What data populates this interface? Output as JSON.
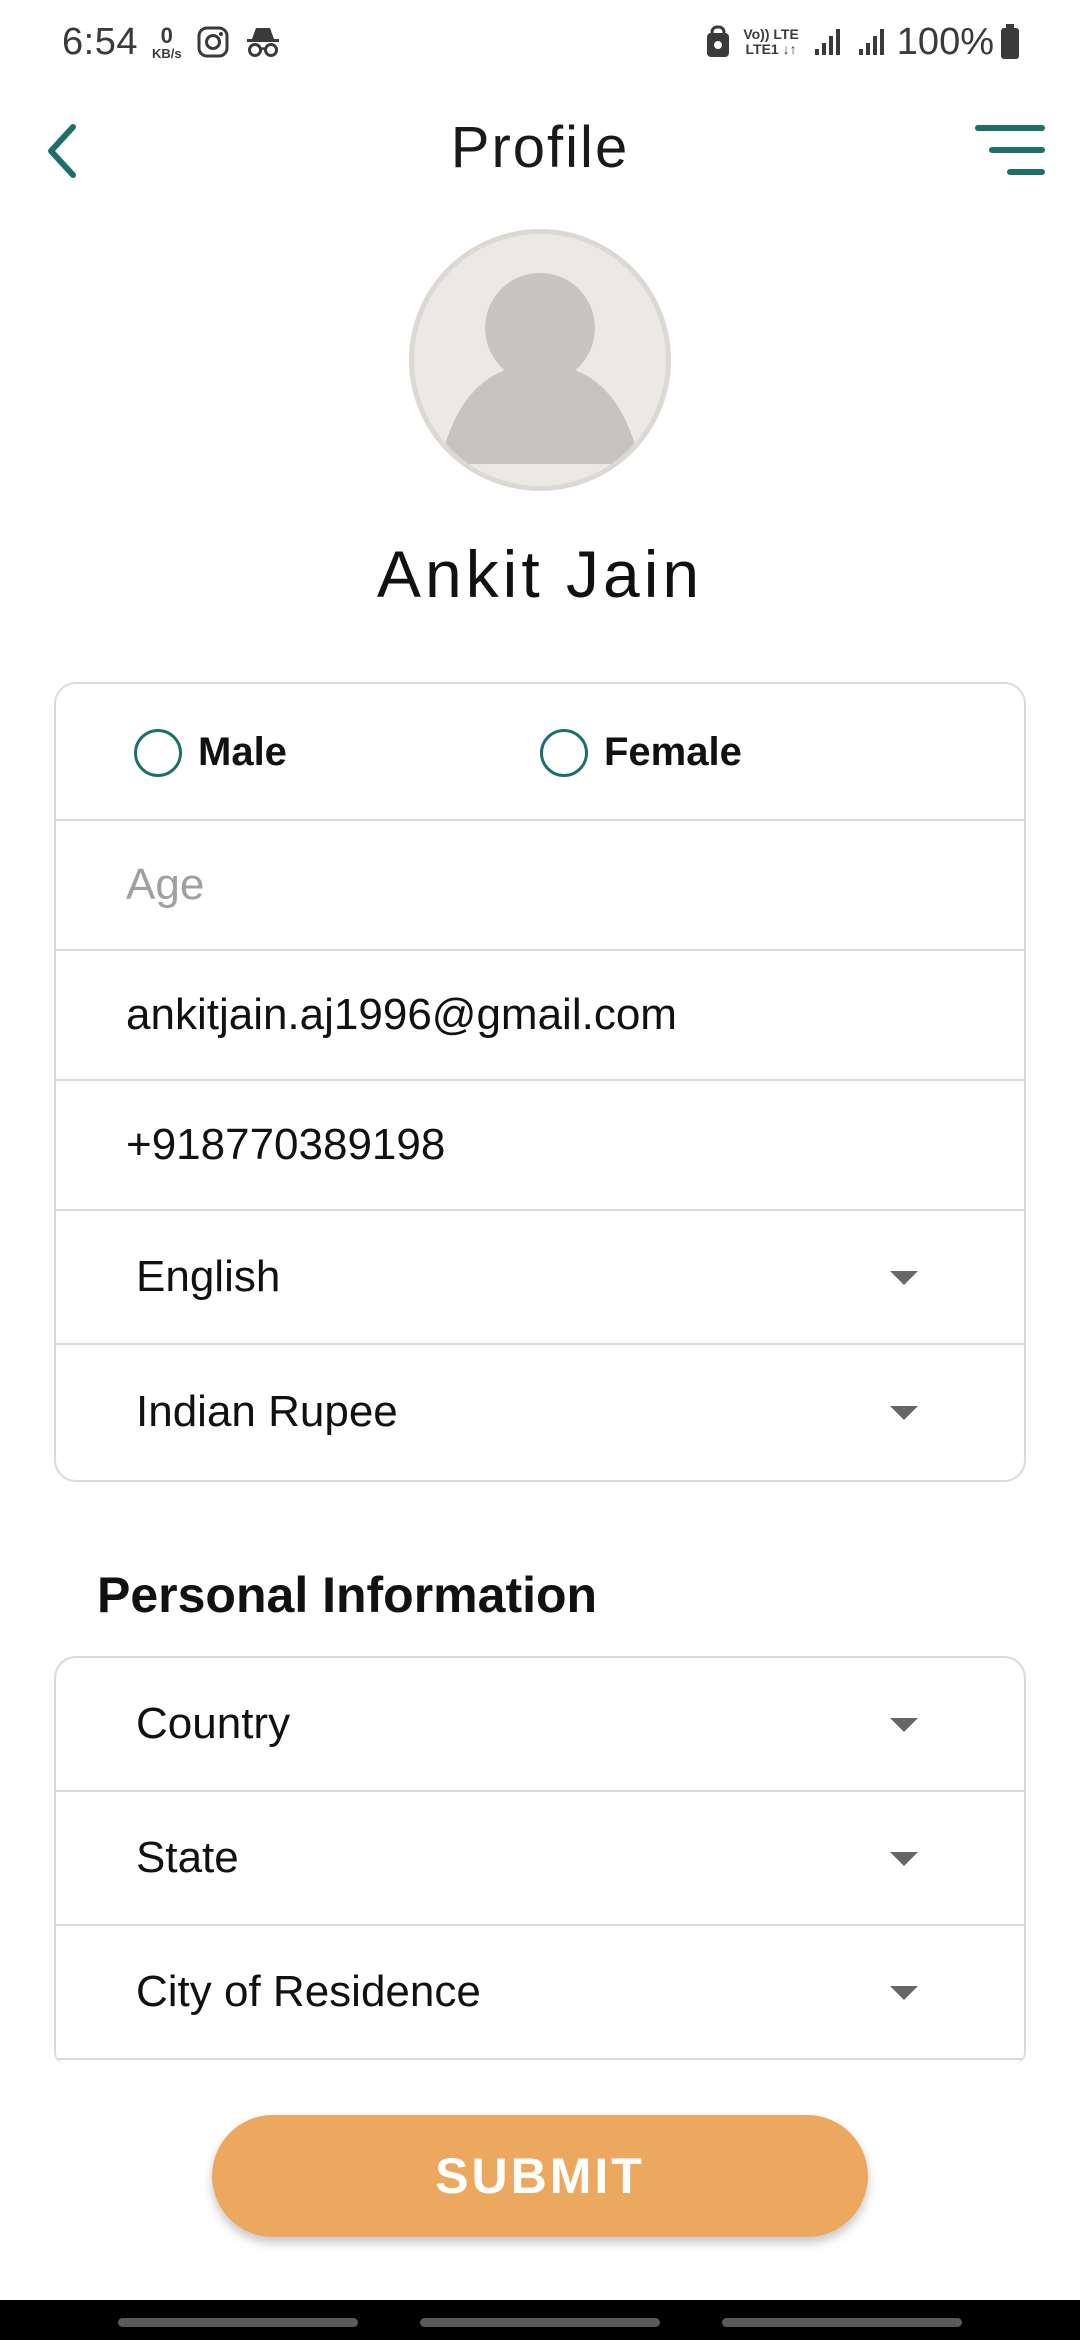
{
  "status_bar": {
    "time": "6:54",
    "net_speed_value": "0",
    "net_speed_unit": "KB/s",
    "net_type_top": "Vo)) LTE",
    "net_type_bottom": "LTE1 ↓↑",
    "battery": "100%",
    "icons": [
      "instagram-icon",
      "incognito-icon",
      "lock-icon",
      "signal-icon",
      "signal-icon",
      "battery-icon"
    ]
  },
  "header": {
    "title": "Profile",
    "back_icon": "chevron-left-icon",
    "menu_icon": "menu-icon"
  },
  "profile": {
    "name": "Ankit Jain",
    "avatar_icon": "user-placeholder-icon"
  },
  "basic_info": {
    "gender_options": [
      "Male",
      "Female"
    ],
    "age_placeholder": "Age",
    "email": "ankitjain.aj1996@gmail.com",
    "phone": "+918770389198",
    "language": "English",
    "currency": "Indian Rupee"
  },
  "personal_info": {
    "title": "Personal Information",
    "country_placeholder": "Country",
    "state_placeholder": "State",
    "city_placeholder": "City of Residence"
  },
  "actions": {
    "submit_label": "SUBMIT"
  },
  "colors": {
    "accent_teal": "#1e6f6a",
    "submit_orange": "#eca85f",
    "border": "#dadada"
  }
}
